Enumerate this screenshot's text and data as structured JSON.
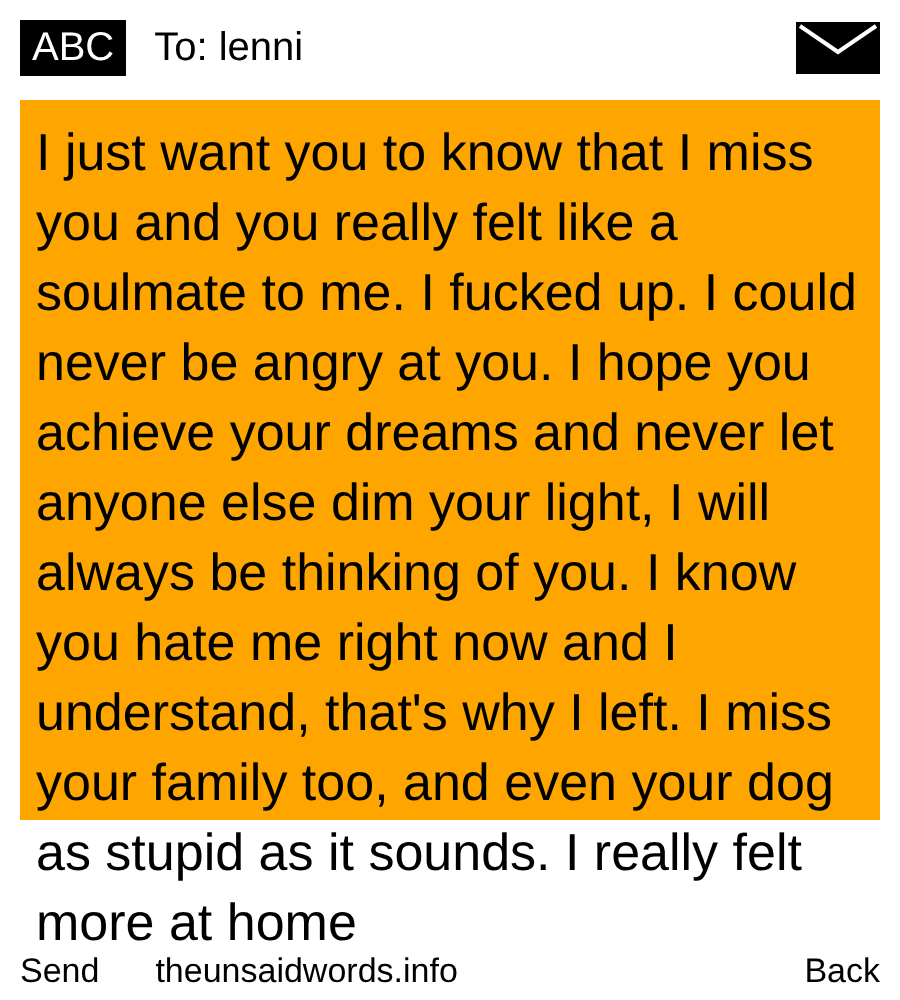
{
  "header": {
    "mode": "ABC",
    "recipient": "To: lenni"
  },
  "message": {
    "text": "I just want you to know that I miss you and you really felt like a soulmate to me. I fucked up. I could never be angry at you. I hope you achieve your dreams and never let anyone else dim your light, I will always be thinking of you. I know you hate me right now and I understand, that's why I left. I miss your family too, and even your dog as stupid as it sounds. I really felt more at home"
  },
  "footer": {
    "left": "Send",
    "center": "theunsaidwords.info",
    "right": "Back"
  }
}
